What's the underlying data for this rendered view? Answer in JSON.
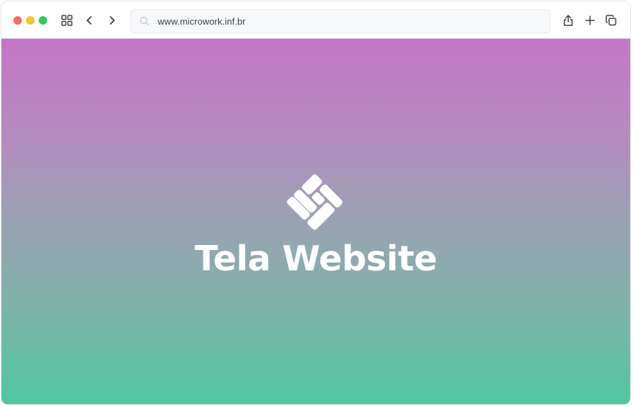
{
  "browser": {
    "url": "www.microwork.inf.br",
    "icons": {
      "grid": "grid-icon",
      "back": "chevron-left-icon",
      "forward": "chevron-right-icon",
      "search": "search-icon",
      "share": "share-icon",
      "new_tab": "plus-icon",
      "tabs": "copy-icon"
    },
    "traffic_colors": {
      "close": "#f86a5f",
      "minimize": "#f8c22e",
      "maximize": "#2ecb58"
    }
  },
  "page": {
    "title": "Tela Website",
    "logo": "diamond-weave-logo",
    "gradient": {
      "top": "#c476c6",
      "bottom": "#4fc7a0"
    }
  }
}
